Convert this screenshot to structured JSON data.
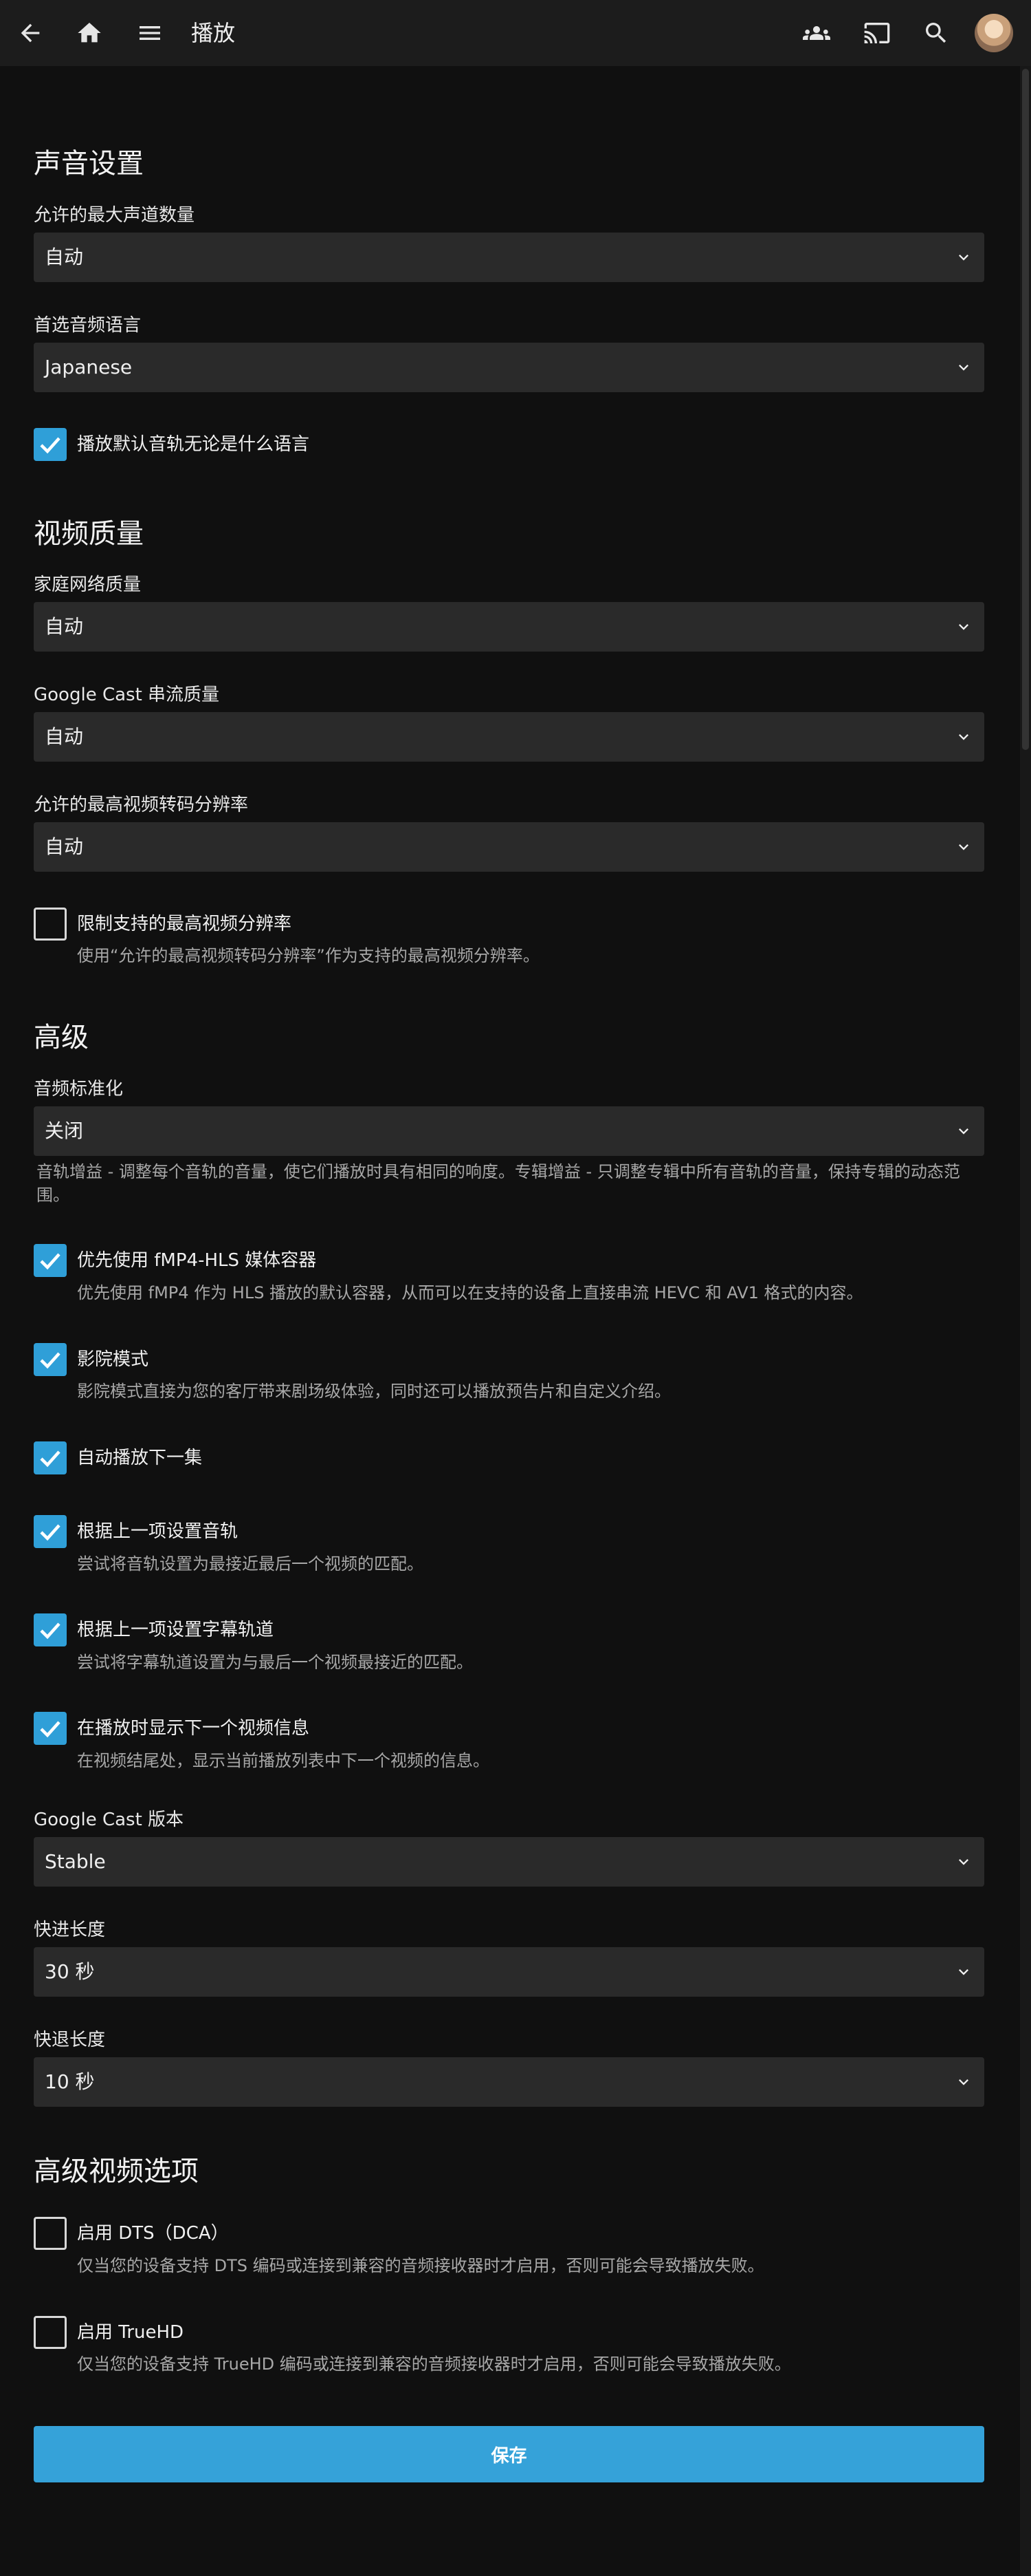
{
  "header": {
    "title": "播放",
    "icons": [
      "back-arrow-icon",
      "home-icon",
      "menu-icon",
      "users-icon",
      "cast-icon",
      "search-icon"
    ]
  },
  "audio": {
    "section_title": "声音设置",
    "max_channels_label": "允许的最大声道数量",
    "max_channels_value": "自动",
    "preferred_language_label": "首选音频语言",
    "preferred_language_value": "Japanese",
    "play_default_track_label": "播放默认音轨无论是什么语言",
    "play_default_track_checked": true
  },
  "video": {
    "section_title": "视频质量",
    "home_quality_label": "家庭网络质量",
    "home_quality_value": "自动",
    "cast_quality_label": "Google Cast 串流质量",
    "cast_quality_value": "自动",
    "max_transcode_label": "允许的最高视频转码分辨率",
    "max_transcode_value": "自动",
    "limit_resolution_label": "限制支持的最高视频分辨率",
    "limit_resolution_help": "使用“允许的最高视频转码分辨率”作为支持的最高视频分辨率。",
    "limit_resolution_checked": false
  },
  "advanced": {
    "section_title": "高级",
    "normalization_label": "音频标准化",
    "normalization_value": "关闭",
    "normalization_help": "音轨增益 - 调整每个音轨的音量，使它们播放时具有相同的响度。专辑增益 - 只调整专辑中所有音轨的音量，保持专辑的动态范围。",
    "fmp4_label": "优先使用 fMP4-HLS 媒体容器",
    "fmp4_help": "优先使用 fMP4 作为 HLS 播放的默认容器，从而可以在支持的设备上直接串流 HEVC 和 AV1 格式的内容。",
    "cinema_label": "影院模式",
    "cinema_help": "影院模式直接为您的客厅带来剧场级体验，同时还可以播放预告片和自定义介绍。",
    "autoplay_label": "自动播放下一集",
    "audio_prev_label": "根据上一项设置音轨",
    "audio_prev_help": "尝试将音轨设置为最接近最后一个视频的匹配。",
    "subtitle_prev_label": "根据上一项设置字幕轨道",
    "subtitle_prev_help": "尝试将字幕轨道设置为与最后一个视频最接近的匹配。",
    "next_info_label": "在播放时显示下一个视频信息",
    "next_info_help": "在视频结尾处，显示当前播放列表中下一个视频的信息。",
    "cast_version_label": "Google Cast 版本",
    "cast_version_value": "Stable",
    "skip_forward_label": "快进长度",
    "skip_forward_value": "30 秒",
    "skip_back_label": "快退长度",
    "skip_back_value": "10 秒"
  },
  "advanced_video": {
    "section_title": "高级视频选项",
    "dts_label": "启用 DTS（DCA）",
    "dts_help": "仅当您的设备支持 DTS 编码或连接到兼容的音频接收器时才启用，否则可能会导致播放失败。",
    "dts_checked": false,
    "truehd_label": "启用 TrueHD",
    "truehd_help": "仅当您的设备支持 TrueHD 编码或连接到兼容的音频接收器时才启用，否则可能会导致播放失败。",
    "truehd_checked": false
  },
  "save_label": "保存",
  "colors": {
    "accent": "#35a2d9",
    "checkbox": "#2f9fd8",
    "background": "#101010",
    "header": "#1c1c1c",
    "select": "#2a2a2a"
  }
}
